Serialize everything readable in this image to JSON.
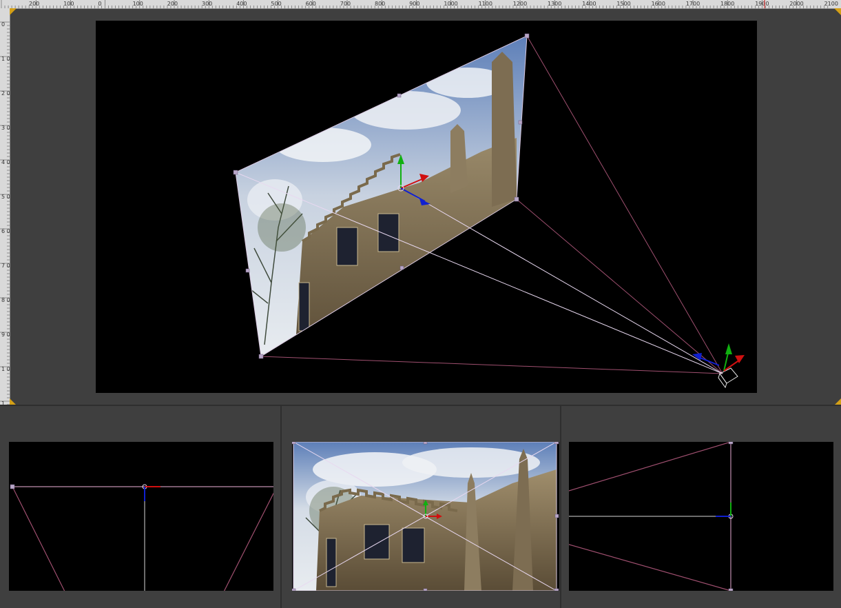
{
  "ruler": {
    "top_labels": [
      "200",
      "100",
      "0",
      "100",
      "200",
      "300",
      "400",
      "500",
      "600",
      "700",
      "800",
      "900",
      "1000",
      "1100",
      "1200",
      "1300",
      "1400",
      "1500",
      "1600",
      "1700",
      "1800",
      "1900",
      "2000",
      "2100"
    ],
    "left_labels": [
      "0",
      "1 0",
      "2 0",
      "3 0",
      "4 0",
      "5 0",
      "6 0",
      "7 0",
      "8 0",
      "9 0",
      "1 0",
      "1"
    ]
  },
  "colors": {
    "background": "#3f3f3f",
    "viewport": "#000000",
    "frustum": "#a05070",
    "selection": "#d8c8e0",
    "axis_x": "#d01010",
    "axis_y": "#10b010",
    "axis_z": "#1020d0",
    "corner": "#d4a017"
  },
  "viewports": {
    "perspective": {
      "name": "perspective-viewport"
    },
    "top": {
      "name": "top-viewport"
    },
    "front": {
      "name": "front-viewport"
    },
    "side": {
      "name": "side-viewport"
    }
  },
  "icons": {
    "camera": "camera-icon",
    "gizmo": "transform-gizmo-icon"
  }
}
